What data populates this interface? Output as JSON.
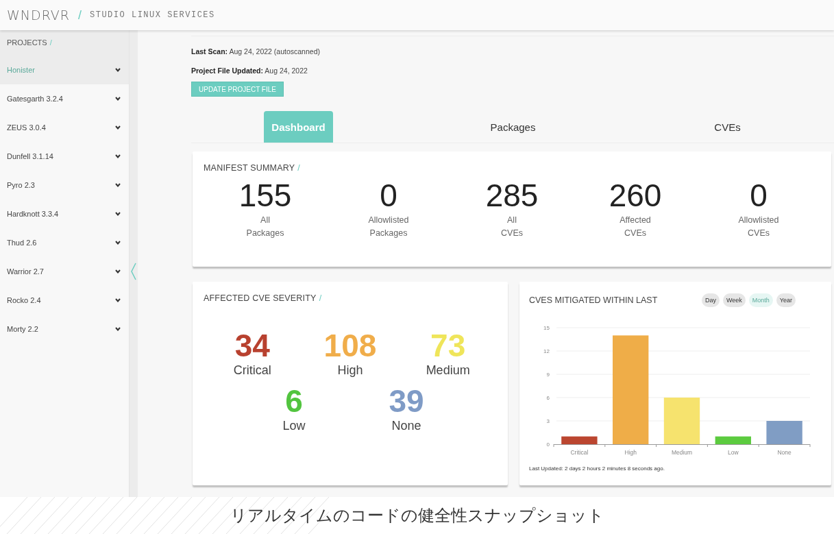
{
  "header": {
    "logo": "WNDRVR",
    "separator": "/",
    "title": "STUDIO LINUX SERVICES"
  },
  "sidebar": {
    "heading": "PROJECTS",
    "heading_mark": "/",
    "items": [
      {
        "label": "Honister",
        "selected": true
      },
      {
        "label": "Gatesgarth 3.2.4",
        "selected": false
      },
      {
        "label": "ZEUS 3.0.4",
        "selected": false
      },
      {
        "label": "Dunfell 3.1.14",
        "selected": false
      },
      {
        "label": "Pyro 2.3",
        "selected": false
      },
      {
        "label": "Hardknott 3.3.4",
        "selected": false
      },
      {
        "label": "Thud 2.6",
        "selected": false
      },
      {
        "label": "Warrior 2.7",
        "selected": false
      },
      {
        "label": "Rocko 2.4",
        "selected": false
      },
      {
        "label": "Morty 2.2",
        "selected": false
      }
    ]
  },
  "scan_info": [
    "**Last Scan:** Aug 24, 2022 (autoscanned)",
    "**Project File Updated:** Aug 24, 2022"
  ],
  "update_button": "UPDATE PROJECT FILE",
  "tabs": [
    {
      "label": "Dashboard",
      "selected": true
    },
    {
      "label": "Packages",
      "selected": false
    },
    {
      "label": "CVEs",
      "selected": false
    }
  ],
  "manifest": {
    "title": "MANIFEST SUMMARY",
    "title_mark": "/",
    "stats": [
      {
        "value": "155",
        "label": "All\nPackages"
      },
      {
        "value": "0",
        "label": "Allowlisted\nPackages"
      },
      {
        "value": "285",
        "label": "All\nCVEs"
      },
      {
        "value": "260",
        "label": "Affected\nCVEs"
      },
      {
        "value": "0",
        "label": "Allowlisted\nCVEs"
      }
    ]
  },
  "severity": {
    "title": "AFFECTED CVE SEVERITY",
    "title_mark": "/",
    "items": [
      {
        "value": "34",
        "label": "Critical",
        "color": "#b8412f"
      },
      {
        "value": "108",
        "label": "High",
        "color": "#f0ad4a"
      },
      {
        "value": "73",
        "label": "Medium",
        "color": "#efe55a"
      },
      {
        "value": "6",
        "label": "Low",
        "color": "#52c43f"
      },
      {
        "value": "39",
        "label": "None",
        "color": "#7f9bc6"
      }
    ]
  },
  "mitigated": {
    "title": "CVES MITIGATED WITHIN LAST",
    "periods": [
      {
        "label": "Day",
        "selected": false
      },
      {
        "label": "Week",
        "selected": false
      },
      {
        "label": "Month",
        "selected": true
      },
      {
        "label": "Year",
        "selected": false
      }
    ],
    "chart_data": {
      "type": "bar",
      "categories": [
        "Critical",
        "High",
        "Medium",
        "Low",
        "None"
      ],
      "values": [
        1,
        14,
        6,
        1,
        3
      ],
      "colors": [
        "#bb4630",
        "#efad48",
        "#f6e36e",
        "#5ccb3f",
        "#809dc4"
      ],
      "grid": true,
      "ylim": [
        0,
        15
      ],
      "yticks": [
        0,
        3,
        6,
        9,
        12,
        15
      ]
    },
    "last_updated": "Last Updated: 2 days 2 hours 2 minutes 8 seconds ago."
  },
  "caption": "リアルタイムのコードの健全性スナップショット"
}
